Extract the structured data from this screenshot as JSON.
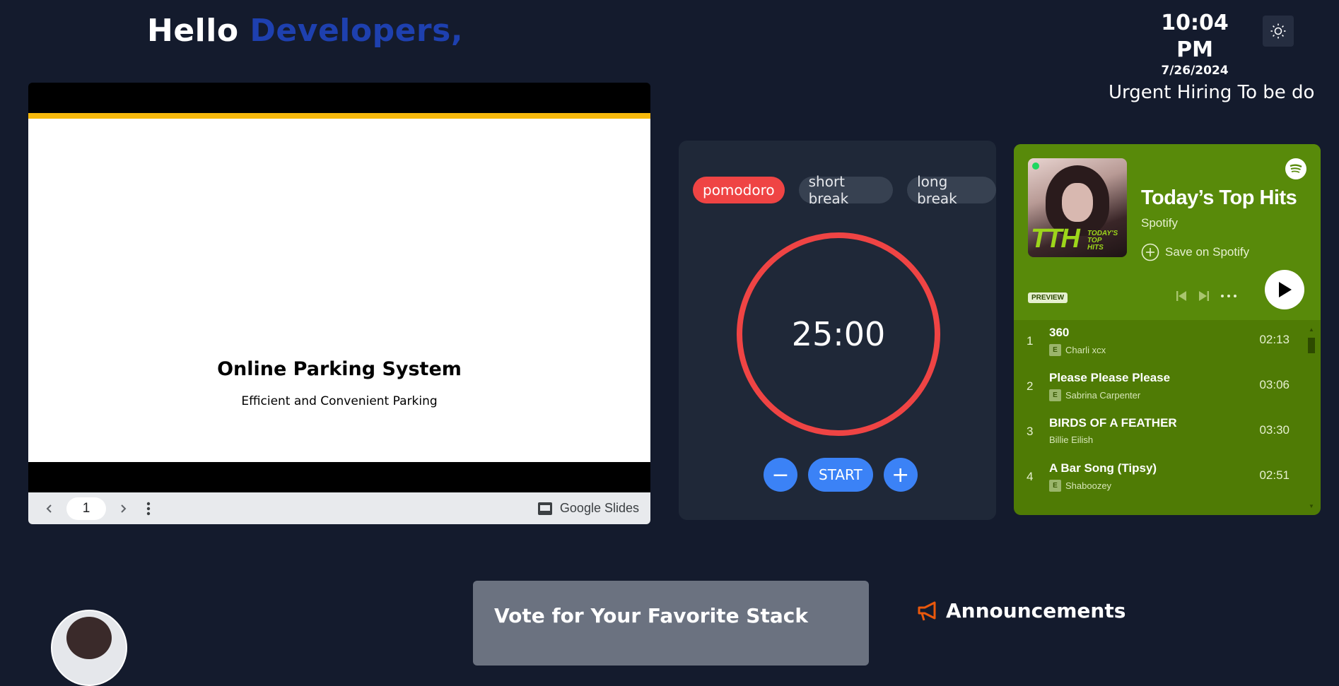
{
  "header": {
    "greeting_prefix": "Hello",
    "greeting_name": "Developers,",
    "time": "10:04 PM",
    "date": "7/26/2024",
    "theme_icon": "sun-icon"
  },
  "marquee": {
    "text": "Urgent Hiring To be done"
  },
  "slides": {
    "title": "Online Parking System",
    "subtitle": "Efficient and Convenient Parking",
    "page": "1",
    "brand": "Google Slides"
  },
  "pomodoro": {
    "tabs": [
      "pomodoro",
      "short break",
      "long break"
    ],
    "active_tab": "pomodoro",
    "timer": "25:00",
    "decrease_label": "−",
    "start_label": "START",
    "increase_label": "+",
    "accent": "#ef4444",
    "button_color": "#3b82f6"
  },
  "spotify": {
    "playlist_title": "Today’s Top Hits",
    "owner": "Spotify",
    "save_label": "Save on Spotify",
    "preview_label": "PREVIEW",
    "background": "#4f7b05",
    "tracks": [
      {
        "num": "1",
        "title": "360",
        "artist": "Charli xcx",
        "explicit": "E",
        "duration": "02:13"
      },
      {
        "num": "2",
        "title": "Please Please Please",
        "artist": "Sabrina Carpenter",
        "explicit": "E",
        "duration": "03:06"
      },
      {
        "num": "3",
        "title": "BIRDS OF A FEATHER",
        "artist": "Billie Eilish",
        "explicit": "",
        "duration": "03:30"
      },
      {
        "num": "4",
        "title": "A Bar Song (Tipsy)",
        "artist": "Shaboozey",
        "explicit": "E",
        "duration": "02:51"
      }
    ]
  },
  "vote": {
    "title": "Vote for Your Favorite Stack"
  },
  "announcements": {
    "title": "Announcements",
    "icon": "megaphone-icon"
  }
}
